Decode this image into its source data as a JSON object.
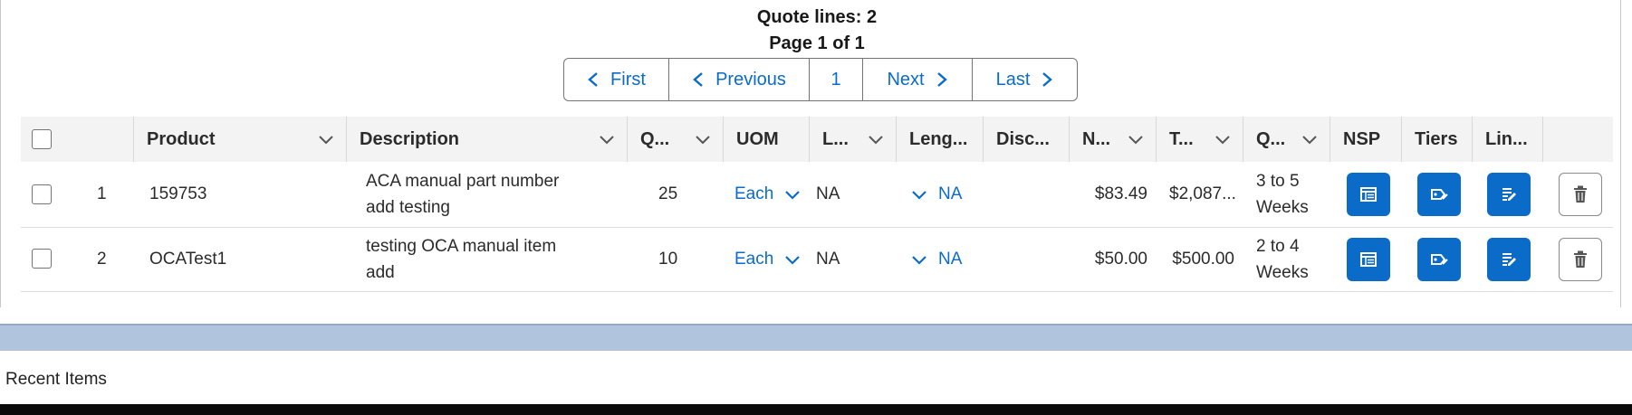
{
  "summary": {
    "quote_lines": "Quote lines: 2",
    "page_info": "Page 1 of 1"
  },
  "pager": {
    "first": "First",
    "previous": "Previous",
    "current": "1",
    "next": "Next",
    "last": "Last"
  },
  "table": {
    "columns": [
      "Product",
      "Description",
      "Q...",
      "UOM",
      "L...",
      "Leng...",
      "Disc...",
      "N...",
      "T...",
      "Q...",
      "NSP",
      "Tiers",
      "Lin..."
    ],
    "rows": [
      {
        "index": "1",
        "product": "159753",
        "description": "ACA manual part number add testing",
        "qty": "25",
        "uom": "Each",
        "l": "NA",
        "length": "NA",
        "disc": "",
        "net": "$83.49",
        "total": "$2,087...",
        "quote_time": "3 to 5 Weeks"
      },
      {
        "index": "2",
        "product": "OCATest1",
        "description": "testing OCA manual item add",
        "qty": "10",
        "uom": "Each",
        "l": "NA",
        "length": "NA",
        "disc": "",
        "net": "$50.00",
        "total": "$500.00",
        "quote_time": "2 to 4 Weeks"
      }
    ]
  },
  "footer": {
    "recent_items": "Recent Items"
  },
  "icons": {
    "nsp": "table-icon",
    "tiers": "tag-edit-icon",
    "lines": "list-edit-icon",
    "delete": "trash-icon"
  },
  "colors": {
    "accent": "#0b6bc9",
    "band": "#b0c4de",
    "header_bg": "#f3f3f3"
  }
}
